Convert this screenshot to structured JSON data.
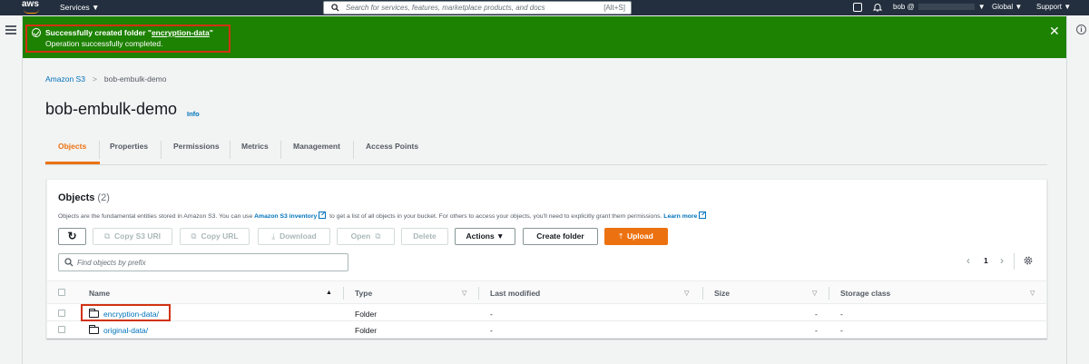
{
  "topnav": {
    "logo": "aws",
    "services": "Services ▼",
    "search_placeholder": "Search for services, features, marketplace products, and docs",
    "search_shortcut": "[Alt+S]",
    "user": "bob @",
    "user_caret": "▼",
    "region": "Global ▼",
    "support": "Support ▼",
    "icons": [
      "cloudshell-icon",
      "bell-icon"
    ]
  },
  "flash": {
    "title_prefix": "Successfully created folder \"",
    "folder_name": "encryption-data",
    "title_suffix": "\"",
    "message": "Operation successfully completed.",
    "close": "✕",
    "color": "#1d8102"
  },
  "breadcrumb": {
    "root": "Amazon S3",
    "separator": ">",
    "current": "bob-embulk-demo"
  },
  "page": {
    "title": "bob-embulk-demo",
    "info": "Info"
  },
  "tabs": [
    "Objects",
    "Properties",
    "Permissions",
    "Metrics",
    "Management",
    "Access Points"
  ],
  "objects": {
    "title": "Objects",
    "count": "(2)",
    "desc_1": "Objects are the fundamental entities stored in Amazon S3. You can use",
    "desc_link_1": "Amazon S3 inventory",
    "desc_2": "to get a list of all objects in your bucket. For others to access your objects, you'll need to explicitly grant them permissions.",
    "desc_link_2": "Learn more",
    "buttons": {
      "refresh": "↻",
      "copy_uri": "Copy S3 URI",
      "copy_url": "Copy URL",
      "download": "Download",
      "open": "Open",
      "delete": "Delete",
      "actions": "Actions ▼",
      "create_folder": "Create folder",
      "upload": "Upload"
    },
    "filter_placeholder": "Find objects by prefix",
    "page": "1",
    "prev": "‹",
    "next": "›",
    "columns": [
      "Name",
      "Type",
      "Last modified",
      "Size",
      "Storage class"
    ],
    "rows": [
      {
        "name": "encryption-data/",
        "type": "Folder",
        "last_modified": "-",
        "size": "-",
        "storage_class": "-"
      },
      {
        "name": "original-data/",
        "type": "Folder",
        "last_modified": "-",
        "size": "-",
        "storage_class": "-"
      }
    ]
  },
  "colors": {
    "nav_bg": "#232f3e",
    "accent": "#ec7211",
    "link": "#0073bb",
    "highlight": "#d13212"
  }
}
